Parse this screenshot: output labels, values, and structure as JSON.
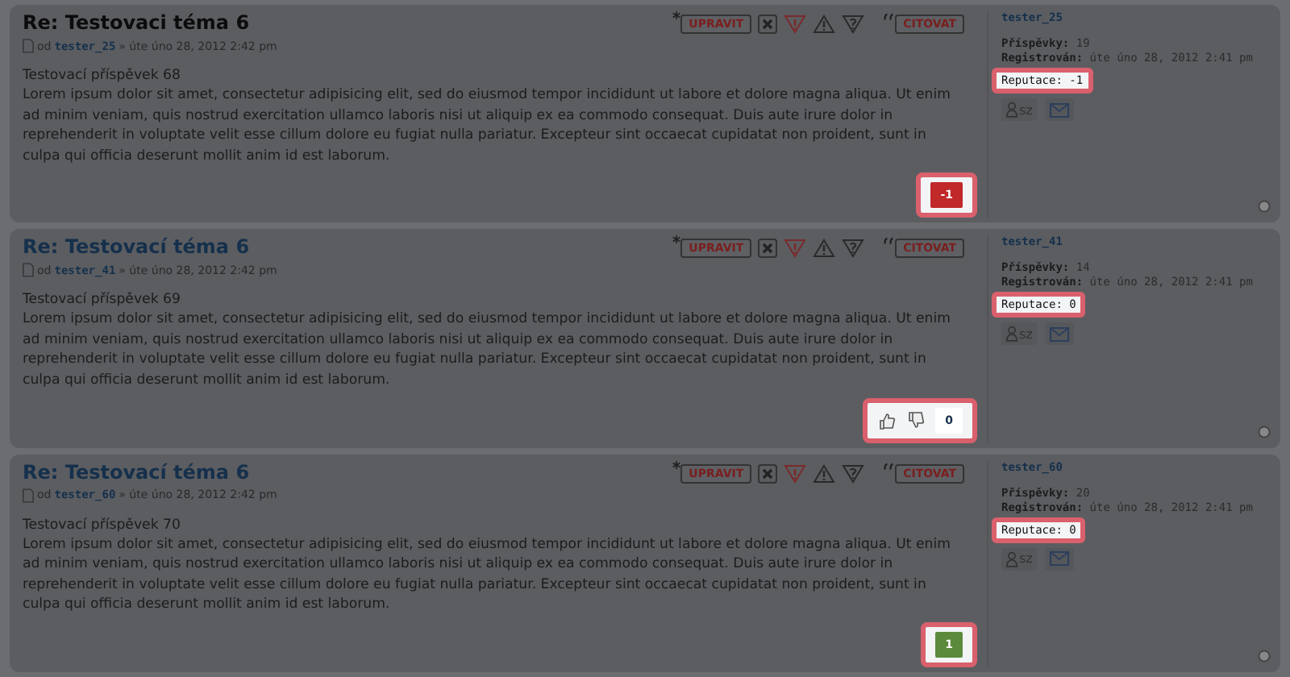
{
  "posts": [
    {
      "title": "Re: Testovaci téma 6",
      "current": true,
      "author_prefix": "od",
      "author": "tester_25",
      "date": "» úte úno 28, 2012 2:42 pm",
      "buttons": [
        {
          "kind": "edit",
          "label": "UPRAVIT"
        },
        {
          "kind": "delete"
        },
        {
          "kind": "report"
        },
        {
          "kind": "warn"
        },
        {
          "kind": "info"
        },
        {
          "kind": "quote",
          "label": "CITOVAT"
        }
      ],
      "heading": "Testovací příspěvek 68",
      "body": "Lorem ipsum dolor sit amet, consectetur adipisicing elit, sed do eiusmod tempor incididunt ut labore et dolore magna aliqua. Ut enim ad minim veniam, quis nostrud exercitation ullamco laboris nisi ut aliquip ex ea commodo consequat. Duis aute irure dolor in reprehenderit in voluptate velit esse cillum dolore eu fugiat nulla pariatur. Excepteur sint occaecat cupidatat non proident, sunt in culpa qui officia deserunt mollit anim id est laborum.",
      "vote": {
        "kind": "score",
        "value": "-1",
        "color": "#c0282a"
      },
      "profile": {
        "username": "tester_25",
        "posts_label": "Příspěvky:",
        "posts": "19",
        "registered_label": "Registrován:",
        "registered": "úte úno 28, 2012 2:41 pm",
        "reputation": "Reputace: -1",
        "pm_label": "sz"
      }
    },
    {
      "title": "Re: Testovací téma 6",
      "current": false,
      "author_prefix": "od",
      "author": "tester_41",
      "date": "» úte úno 28, 2012 2:42 pm",
      "buttons": [
        {
          "kind": "edit",
          "label": "UPRAVIT"
        },
        {
          "kind": "delete"
        },
        {
          "kind": "report"
        },
        {
          "kind": "warn"
        },
        {
          "kind": "info"
        },
        {
          "kind": "quote",
          "label": "CITOVAT"
        }
      ],
      "heading": "Testovací příspěvek 69",
      "body": "Lorem ipsum dolor sit amet, consectetur adipisicing elit, sed do eiusmod tempor incididunt ut labore et dolore magna aliqua. Ut enim ad minim veniam, quis nostrud exercitation ullamco laboris nisi ut aliquip ex ea commodo consequat. Duis aute irure dolor in reprehenderit in voluptate velit esse cillum dolore eu fugiat nulla pariatur. Excepteur sint occaecat cupidatat non proident, sunt in culpa qui officia deserunt mollit anim id est laborum.",
      "vote": {
        "kind": "buttons",
        "value": "0",
        "color": "#ffffff"
      },
      "profile": {
        "username": "tester_41",
        "posts_label": "Příspěvky:",
        "posts": "14",
        "registered_label": "Registrován:",
        "registered": "úte úno 28, 2012 2:41 pm",
        "reputation": "Reputace: 0",
        "pm_label": "sz"
      }
    },
    {
      "title": "Re: Testovací téma 6",
      "current": false,
      "author_prefix": "od",
      "author": "tester_60",
      "date": "» úte úno 28, 2012 2:42 pm",
      "buttons": [
        {
          "kind": "edit",
          "label": "UPRAVIT"
        },
        {
          "kind": "delete"
        },
        {
          "kind": "report"
        },
        {
          "kind": "warn"
        },
        {
          "kind": "info"
        },
        {
          "kind": "quote",
          "label": "CITOVAT"
        }
      ],
      "heading": "Testovací příspěvek 70",
      "body": "Lorem ipsum dolor sit amet, consectetur adipisicing elit, sed do eiusmod tempor incididunt ut labore et dolore magna aliqua. Ut enim ad minim veniam, quis nostrud exercitation ullamco laboris nisi ut aliquip ex ea commodo consequat. Duis aute irure dolor in reprehenderit in voluptate velit esse cillum dolore eu fugiat nulla pariatur. Excepteur sint occaecat cupidatat non proident, sunt in culpa qui officia deserunt mollit anim id est laborum.",
      "vote": {
        "kind": "score",
        "value": "1",
        "color": "#5c8a3c"
      },
      "profile": {
        "username": "tester_60",
        "posts_label": "Příspěvky:",
        "posts": "20",
        "registered_label": "Registrován:",
        "registered": "úte úno 28, 2012 2:41 pm",
        "reputation": "Reputace: 0",
        "pm_label": "sz"
      }
    }
  ]
}
